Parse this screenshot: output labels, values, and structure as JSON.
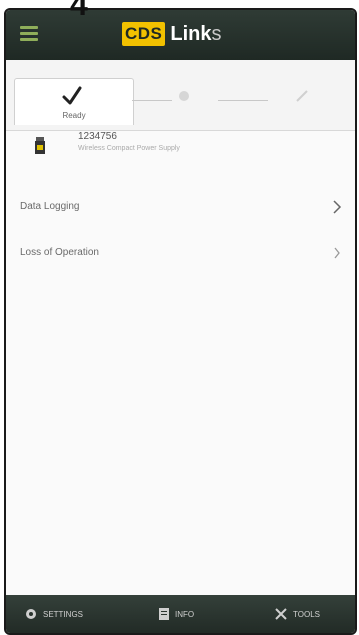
{
  "step_number": "4",
  "header": {
    "brand_box": "CDS",
    "brand_text": "Link",
    "brand_text_accent": "s"
  },
  "tabs": [
    {
      "label": "Ready"
    },
    {
      "label": ""
    },
    {
      "label": ""
    }
  ],
  "device": {
    "name": "1234756",
    "sub": "Wireless Compact Power Supply"
  },
  "list": [
    {
      "label": "Data Logging"
    },
    {
      "label": "Loss of Operation"
    }
  ],
  "bottombar": {
    "items": [
      {
        "label": "SETTINGS"
      },
      {
        "label": "INFO"
      },
      {
        "label": "TOOLS"
      }
    ]
  },
  "colors": {
    "header_bg": "#1f2924",
    "brand_yellow": "#f2c100",
    "menu_green": "#8fae5a"
  }
}
